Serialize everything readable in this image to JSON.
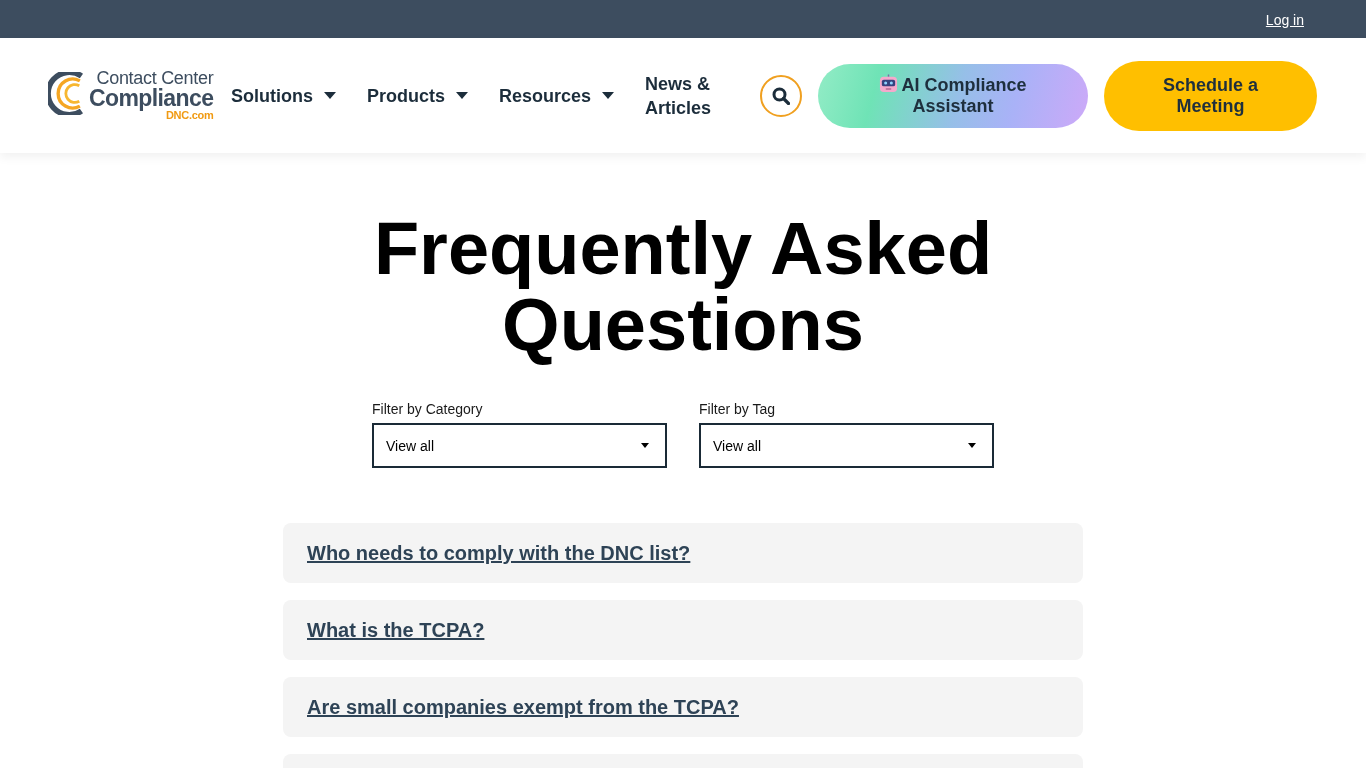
{
  "top_bar": {
    "login_link": "Log in"
  },
  "header": {
    "logo": {
      "line_1": "Contact Center",
      "line_2": "Compliance",
      "line_3": "DNC.com"
    },
    "nav": [
      {
        "label": "Solutions",
        "dropdown": true
      },
      {
        "label": "Products",
        "dropdown": true
      },
      {
        "label": "Resources",
        "dropdown": true
      },
      {
        "label": "News & Articles",
        "dropdown": false
      }
    ],
    "buttons": [
      {
        "label": "AI Compliance Assistant",
        "kind": "ai"
      },
      {
        "label": "Schedule a Meeting",
        "kind": "cta"
      }
    ]
  },
  "page_title": "Frequently Asked Questions",
  "filters": [
    {
      "label": "Filter by Category",
      "value": "View all"
    },
    {
      "label": "Filter by Tag",
      "value": "View all"
    }
  ],
  "faq": {
    "items": [
      {
        "question": "Who needs to comply with the DNC list?"
      },
      {
        "question": "What is the TCPA?"
      },
      {
        "question": "Are small companies exempt from the TCPA?"
      }
    ],
    "more_below": true
  }
}
